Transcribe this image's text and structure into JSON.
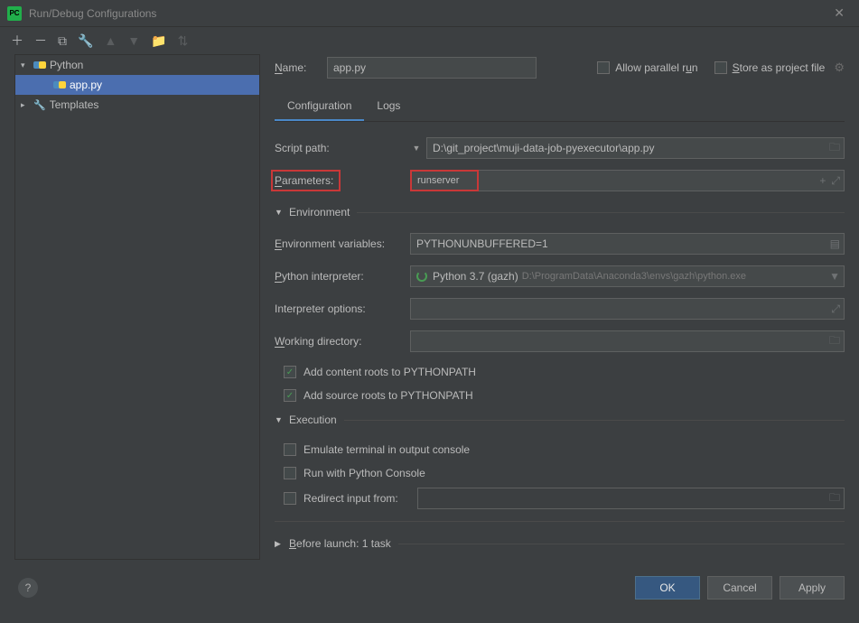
{
  "window": {
    "title": "Run/Debug Configurations"
  },
  "nameRow": {
    "label": "Name:",
    "value": "app.py",
    "allowParallel": "Allow parallel run",
    "storeProject": "Store as project file"
  },
  "tree": {
    "python": "Python",
    "app": "app.py",
    "templates": "Templates"
  },
  "tabs": {
    "config": "Configuration",
    "logs": "Logs"
  },
  "form": {
    "scriptPathLabel": "Script path:",
    "scriptPath": "D:\\git_project\\muji-data-job-pyexecutor\\app.py",
    "parametersLabel": "Parameters:",
    "parameters": "runserver",
    "envSection": "Environment",
    "envVarsLabel": "Environment variables:",
    "envVars": "PYTHONUNBUFFERED=1",
    "interpLabel": "Python interpreter:",
    "interpName": "Python 3.7 (gazh)",
    "interpPath": "D:\\ProgramData\\Anaconda3\\envs\\gazh\\python.exe",
    "interpOptsLabel": "Interpreter options:",
    "workDirLabel": "Working directory:",
    "addContent": "Add content roots to PYTHONPATH",
    "addSource": "Add source roots to PYTHONPATH",
    "execSection": "Execution",
    "emulate": "Emulate terminal in output console",
    "runConsole": "Run with Python Console",
    "redirect": "Redirect input from:",
    "beforeLaunch": "Before launch: 1 task"
  },
  "buttons": {
    "ok": "OK",
    "cancel": "Cancel",
    "apply": "Apply"
  }
}
